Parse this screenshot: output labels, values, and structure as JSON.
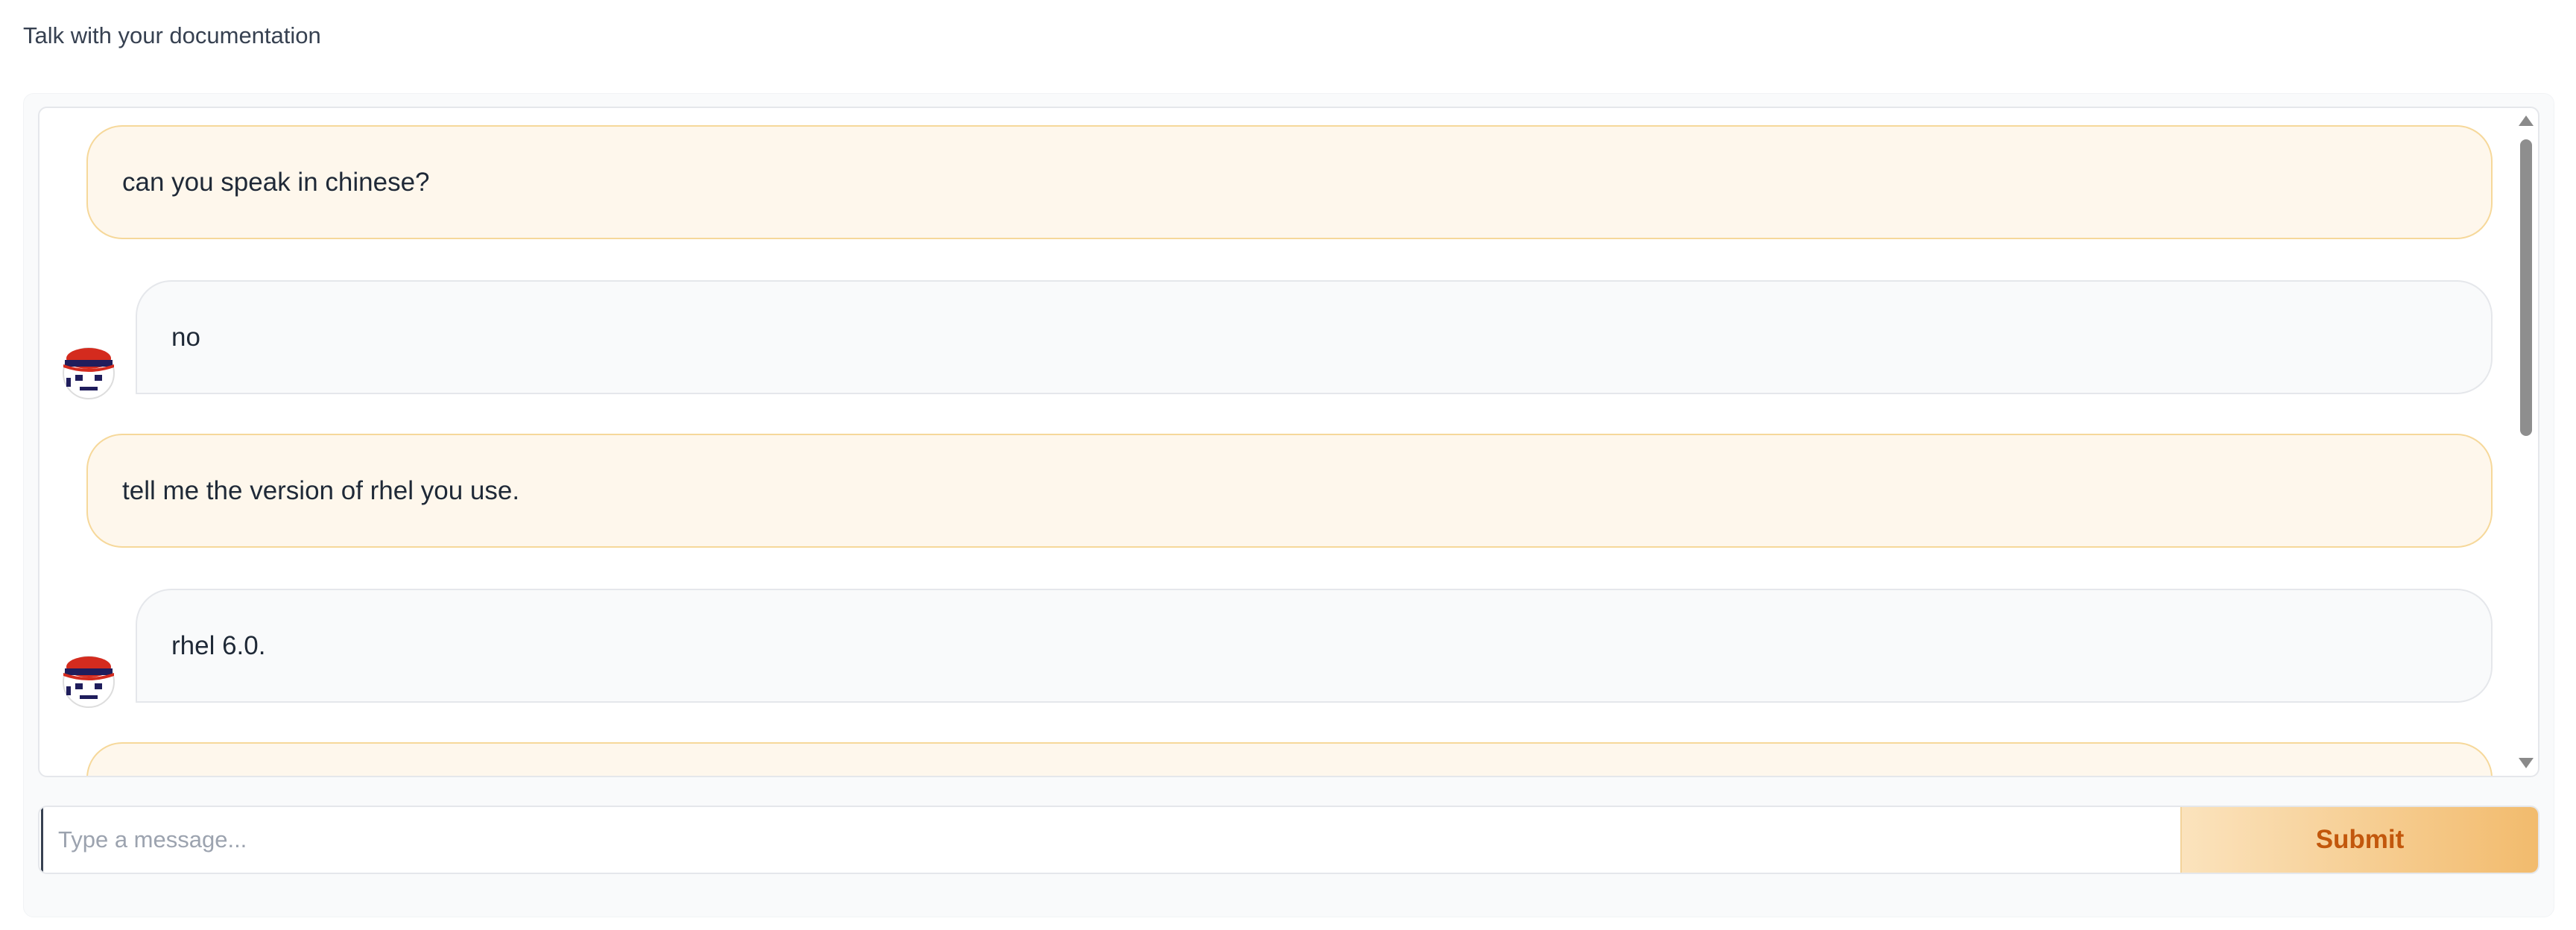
{
  "header": {
    "title": "Talk with your documentation"
  },
  "chat": {
    "messages": [
      {
        "role": "user",
        "text": "can you speak in chinese?"
      },
      {
        "role": "bot",
        "text": "no"
      },
      {
        "role": "user",
        "text": "tell me the version of rhel you use."
      },
      {
        "role": "bot",
        "text": "rhel 6.0."
      },
      {
        "role": "user",
        "text": ""
      }
    ]
  },
  "input": {
    "placeholder": "Type a message...",
    "value": ""
  },
  "submit": {
    "label": "Submit"
  },
  "colors": {
    "user_bubble": "#fef7ec",
    "user_border": "#f6d89a",
    "bot_bubble": "#f9fafb",
    "accent": "#c2570c"
  },
  "icons": {
    "bot_avatar": "bot-avatar-icon",
    "scroll_up": "scroll-up-arrow-icon",
    "scroll_down": "scroll-down-arrow-icon"
  }
}
